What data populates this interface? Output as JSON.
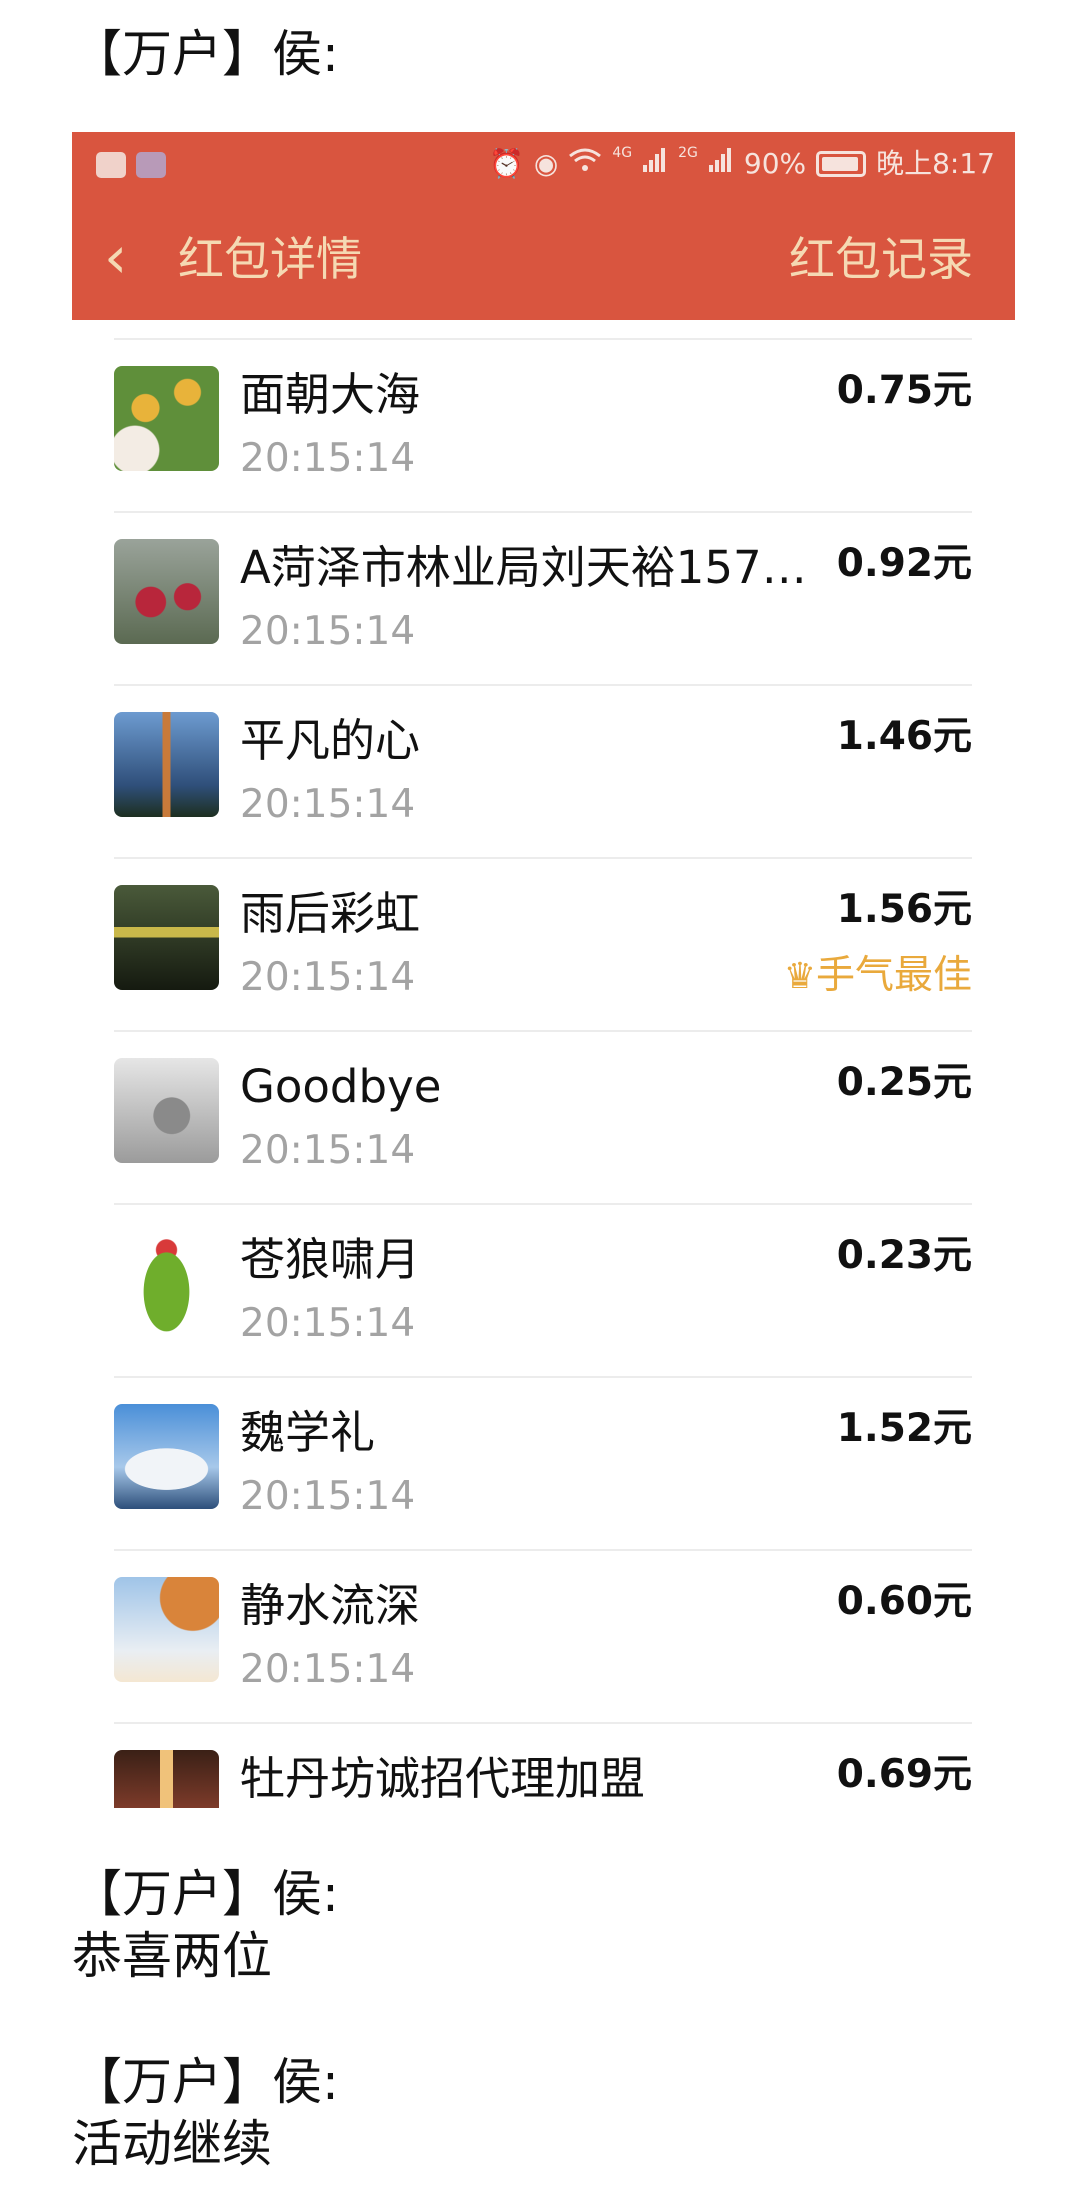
{
  "chat": {
    "messages": [
      {
        "sender": "【万户】侯:",
        "text": ""
      },
      {
        "sender": "【万户】侯:",
        "text": "恭喜两位"
      },
      {
        "sender": "【万户】侯:",
        "text": "活动继续"
      }
    ]
  },
  "status_bar": {
    "battery": "90%",
    "network_1": "4G",
    "network_2": "2G",
    "time": "晚上8:17",
    "icons": [
      "activity-icon",
      "shield-icon",
      "alarm-icon",
      "eye-icon",
      "wifi-icon",
      "signal-icon",
      "signal-icon",
      "battery-icon"
    ]
  },
  "navbar": {
    "back_icon": "chevron-left-icon",
    "title": "红包详情",
    "right_action": "红包记录",
    "color": "#d9553f",
    "text_color": "#f5d9b3"
  },
  "recipients": [
    {
      "name": "面朝大海",
      "time": "20:15:14",
      "amount": "0.75元",
      "avatar_colors": [
        "#5f8f3a",
        "#e8b33a"
      ]
    },
    {
      "name": "A菏泽市林业局刘天裕1575...",
      "time": "20:15:14",
      "amount": "0.92元",
      "avatar_colors": [
        "#7a7f74",
        "#b8263b"
      ]
    },
    {
      "name": "平凡的心",
      "time": "20:15:14",
      "amount": "1.46元",
      "avatar_colors": [
        "#3d6fa6",
        "#c87a3a"
      ]
    },
    {
      "name": "雨后彩虹",
      "time": "20:15:14",
      "amount": "1.56元",
      "best_label": "手气最佳",
      "avatar_colors": [
        "#2a3320",
        "#c9b84a"
      ]
    },
    {
      "name": "Goodbye",
      "time": "20:15:14",
      "amount": "0.25元",
      "avatar_colors": [
        "#d7d7d7",
        "#5b5b5b"
      ]
    },
    {
      "name": "苍狼啸月",
      "time": "20:15:14",
      "amount": "0.23元",
      "avatar_colors": [
        "#ffffff",
        "#6fae2c"
      ]
    },
    {
      "name": "魏学礼",
      "time": "20:15:14",
      "amount": "1.52元",
      "avatar_colors": [
        "#4a8fd8",
        "#e6eef5"
      ]
    },
    {
      "name": "静水流深",
      "time": "20:15:14",
      "amount": "0.60元",
      "avatar_colors": [
        "#cfe1f2",
        "#d9843a"
      ]
    },
    {
      "name": "牡丹坊诚招代理加盟",
      "time": "",
      "amount": "0.69元",
      "avatar_colors": [
        "#7a3a2a",
        "#e6b47a"
      ]
    }
  ],
  "colors": {
    "best_label": "#e9a93c",
    "time_text": "#a3a3a3"
  }
}
